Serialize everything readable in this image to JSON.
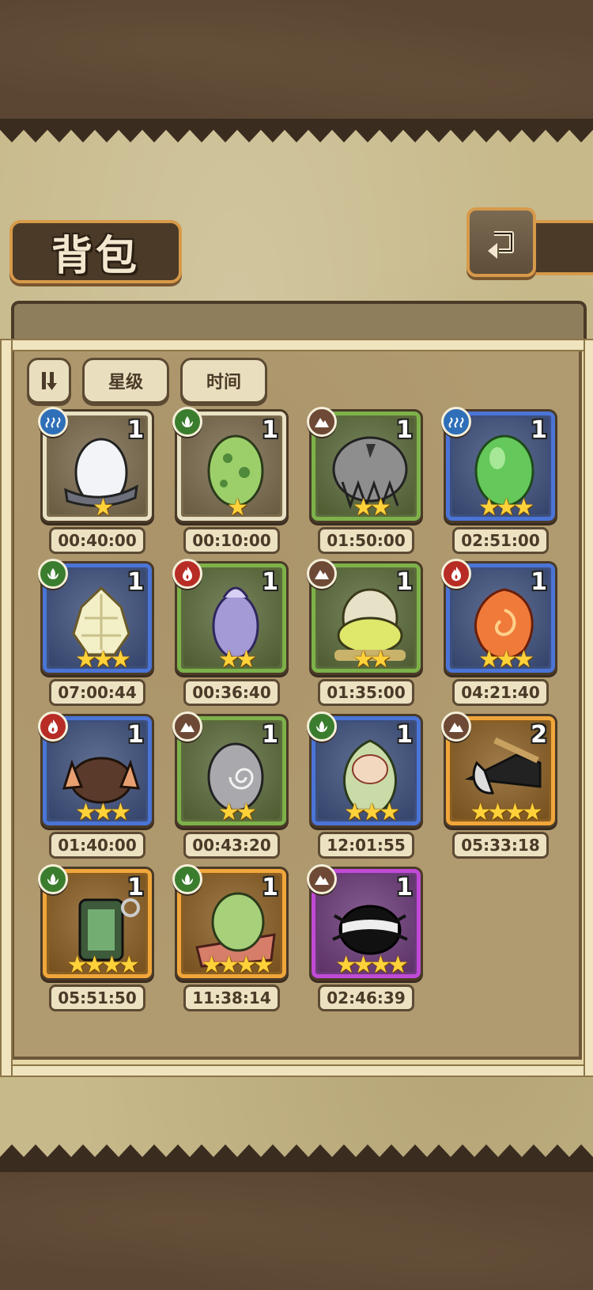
{
  "header": {
    "title": "背包"
  },
  "filters": {
    "sort_toggle": "sort-toggle",
    "star_label": "星级",
    "time_label": "时间"
  },
  "eggs": [
    {
      "count": "1",
      "stars": "★",
      "timer": "00:40:00",
      "element": "water",
      "frame": "white"
    },
    {
      "count": "1",
      "stars": "★",
      "timer": "00:10:00",
      "element": "grass",
      "frame": "white"
    },
    {
      "count": "1",
      "stars": "★★",
      "timer": "01:50:00",
      "element": "earth",
      "frame": "green"
    },
    {
      "count": "1",
      "stars": "★★★",
      "timer": "02:51:00",
      "element": "water",
      "frame": "blue"
    },
    {
      "count": "1",
      "stars": "★★★",
      "timer": "07:00:44",
      "element": "grass",
      "frame": "blue"
    },
    {
      "count": "1",
      "stars": "★★",
      "timer": "00:36:40",
      "element": "fire",
      "frame": "green"
    },
    {
      "count": "1",
      "stars": "★★",
      "timer": "01:35:00",
      "element": "earth",
      "frame": "green"
    },
    {
      "count": "1",
      "stars": "★★★",
      "timer": "04:21:40",
      "element": "fire",
      "frame": "blue"
    },
    {
      "count": "1",
      "stars": "★★★",
      "timer": "01:40:00",
      "element": "fire",
      "frame": "blue"
    },
    {
      "count": "1",
      "stars": "★★",
      "timer": "00:43:20",
      "element": "earth",
      "frame": "green"
    },
    {
      "count": "1",
      "stars": "★★★",
      "timer": "12:01:55",
      "element": "grass",
      "frame": "blue"
    },
    {
      "count": "2",
      "stars": "★★★★",
      "timer": "05:33:18",
      "element": "earth",
      "frame": "gold"
    },
    {
      "count": "1",
      "stars": "★★★★",
      "timer": "05:51:50",
      "element": "grass",
      "frame": "gold"
    },
    {
      "count": "1",
      "stars": "★★★★",
      "timer": "11:38:14",
      "element": "grass",
      "frame": "gold"
    },
    {
      "count": "1",
      "stars": "★★★★",
      "timer": "02:46:39",
      "element": "earth",
      "frame": "purple"
    }
  ],
  "colors": {
    "parchment": "#c7b98a",
    "panel": "#b09a6f",
    "plaque": "#4b3a27",
    "plaque_border": "#d79a4a",
    "star": "#ffd23a"
  }
}
